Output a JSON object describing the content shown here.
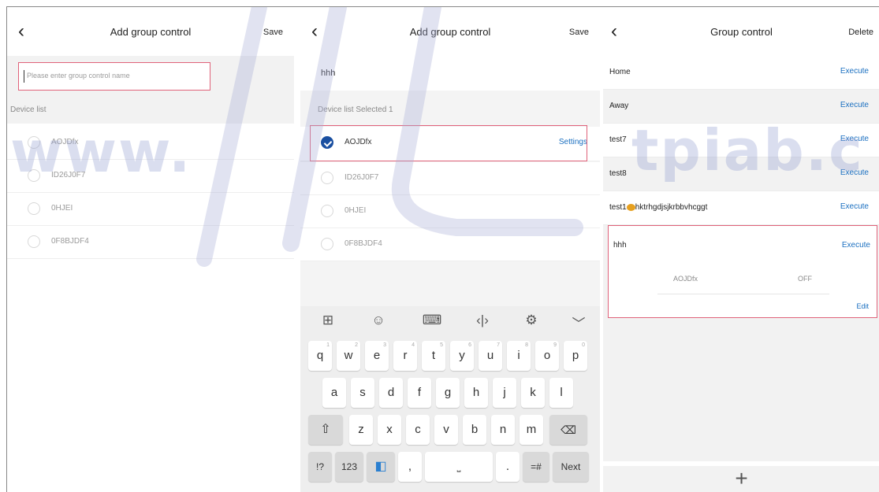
{
  "panel1": {
    "title": "Add group control",
    "save_label": "Save",
    "name_placeholder": "Please enter group control name",
    "device_list_label": "Device list",
    "devices": [
      {
        "name": "AOJDfx"
      },
      {
        "name": "ID26J0F7"
      },
      {
        "name": "0HJEI"
      },
      {
        "name": "0F8BJDF4"
      }
    ]
  },
  "panel2": {
    "title": "Add group control",
    "save_label": "Save",
    "name_value": "hhh",
    "device_list_label": "Device list Selected 1",
    "devices": [
      {
        "name": "AOJDfx",
        "selected": true,
        "action": "Settings"
      },
      {
        "name": "ID26J0F7",
        "selected": false
      },
      {
        "name": "0HJEI",
        "selected": false
      },
      {
        "name": "0F8BJDF4",
        "selected": false
      }
    ],
    "keyboard": {
      "row1": [
        "q",
        "w",
        "e",
        "r",
        "t",
        "y",
        "u",
        "i",
        "o",
        "p"
      ],
      "row1_hints": [
        "1",
        "2",
        "3",
        "4",
        "5",
        "6",
        "7",
        "8",
        "9",
        "0"
      ],
      "row2": [
        "a",
        "s",
        "d",
        "f",
        "g",
        "h",
        "j",
        "k",
        "l"
      ],
      "row3": [
        "z",
        "x",
        "c",
        "v",
        "b",
        "n",
        "m"
      ],
      "bottom": {
        "sym": "!?",
        "num": "123",
        "comma": ",",
        "dot": ".",
        "punct": "=#",
        "next": "Next"
      }
    }
  },
  "panel3": {
    "title": "Group control",
    "delete_label": "Delete",
    "execute_label": "Execute",
    "groups": [
      {
        "name": "Home"
      },
      {
        "name": "Away"
      },
      {
        "name": "test7"
      },
      {
        "name": "test8"
      },
      {
        "name_prefix": "test1",
        "name_suffix": "hktrhgdjsjkrbbvhcggt"
      }
    ],
    "expanded_group": {
      "name": "hhh",
      "device": "AOJDfx",
      "state": "OFF",
      "edit_label": "Edit"
    }
  },
  "watermark": {
    "left": "www.",
    "right": "tpiab.c"
  },
  "colors": {
    "accent_blue": "#1a6fc0",
    "highlight_box": "#e0627a",
    "selected_radio": "#1a4fa0"
  }
}
